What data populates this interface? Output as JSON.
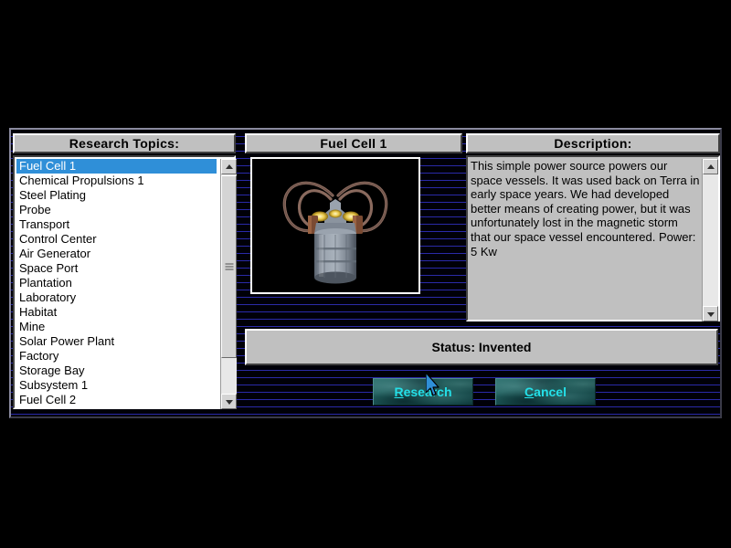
{
  "colors": {
    "dialog_bg": "#000008",
    "scanline": "#2a2aa8",
    "panel_face": "#c0c0c0",
    "selection": "#2f8fd8",
    "button_face": "#17504f",
    "button_text": "#24e0e8",
    "desc_face": "#c0c0c0"
  },
  "headers": {
    "topics": "Research Topics:",
    "item_name": "Fuel Cell 1",
    "description": "Description:"
  },
  "topics": {
    "selected_index": 0,
    "items": [
      {
        "label": "Fuel Cell 1"
      },
      {
        "label": "Chemical Propulsions 1"
      },
      {
        "label": "Steel Plating"
      },
      {
        "label": "Probe"
      },
      {
        "label": "Transport"
      },
      {
        "label": "Control Center"
      },
      {
        "label": "Air Generator"
      },
      {
        "label": "Space Port"
      },
      {
        "label": "Plantation"
      },
      {
        "label": "Laboratory"
      },
      {
        "label": "Habitat"
      },
      {
        "label": "Mine"
      },
      {
        "label": "Solar Power Plant"
      },
      {
        "label": "Factory"
      },
      {
        "label": "Storage Bay"
      },
      {
        "label": "Subsystem 1"
      },
      {
        "label": "Fuel Cell 2"
      }
    ]
  },
  "preview": {
    "alt": "fuel-cell-render"
  },
  "description": {
    "text": "This simple power source powers our space vessels.  It was used back on Terra in early space years. We had developed better means of creating power, but it was unfortunately lost in the magnetic storm that our space vessel encountered.  Power: 5 Kw"
  },
  "status": {
    "text": "Status: Invented"
  },
  "buttons": {
    "research": {
      "accel": "R",
      "rest": "esearch"
    },
    "cancel": {
      "accel": "C",
      "rest": "ancel"
    }
  }
}
